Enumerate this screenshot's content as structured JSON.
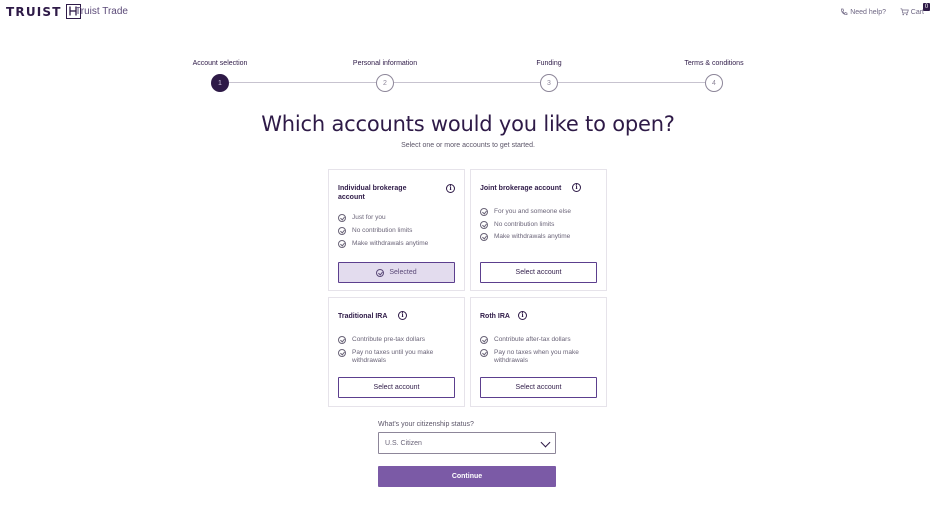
{
  "header": {
    "logo_text": "TRUIST",
    "app_name": "Truist Trade",
    "need_help": "Need help?",
    "cart_label": "Cart",
    "cart_count": "0"
  },
  "stepper": {
    "steps": [
      {
        "label": "Account selection",
        "number": "1",
        "state": "active"
      },
      {
        "label": "Personal information",
        "number": "2",
        "state": "inactive"
      },
      {
        "label": "Funding",
        "number": "3",
        "state": "inactive"
      },
      {
        "label": "Terms & conditions",
        "number": "4",
        "state": "inactive"
      }
    ]
  },
  "main": {
    "title": "Which accounts would you like to open?",
    "subtitle": "Select one or more accounts to get started."
  },
  "cards": [
    {
      "title_line1": "Individual brokerage",
      "title_line2": "account",
      "features": [
        "Just for you",
        "No contribution limits",
        "Make withdrawals anytime"
      ],
      "button_label": "Selected",
      "selected": true
    },
    {
      "title_line1": "Joint brokerage account",
      "features": [
        "For you and someone else",
        "No contribution limits",
        "Make withdrawals anytime"
      ],
      "button_label": "Select account",
      "selected": false
    },
    {
      "title_line1": "Traditional IRA",
      "features": [
        "Contribute pre-tax dollars",
        "Pay no taxes until you make withdrawals"
      ],
      "button_label": "Select account",
      "selected": false
    },
    {
      "title_line1": "Roth IRA",
      "features": [
        "Contribute after-tax dollars",
        "Pay no taxes when you make withdrawals"
      ],
      "button_label": "Select account",
      "selected": false
    }
  ],
  "citizenship": {
    "label": "What's your citizenship status?",
    "value": "U.S. Citizen"
  },
  "continue_label": "Continue",
  "colors": {
    "brand_dark": "#2e1a47",
    "brand_button": "#7b5aa6",
    "selected_bg": "#e3dcee"
  }
}
